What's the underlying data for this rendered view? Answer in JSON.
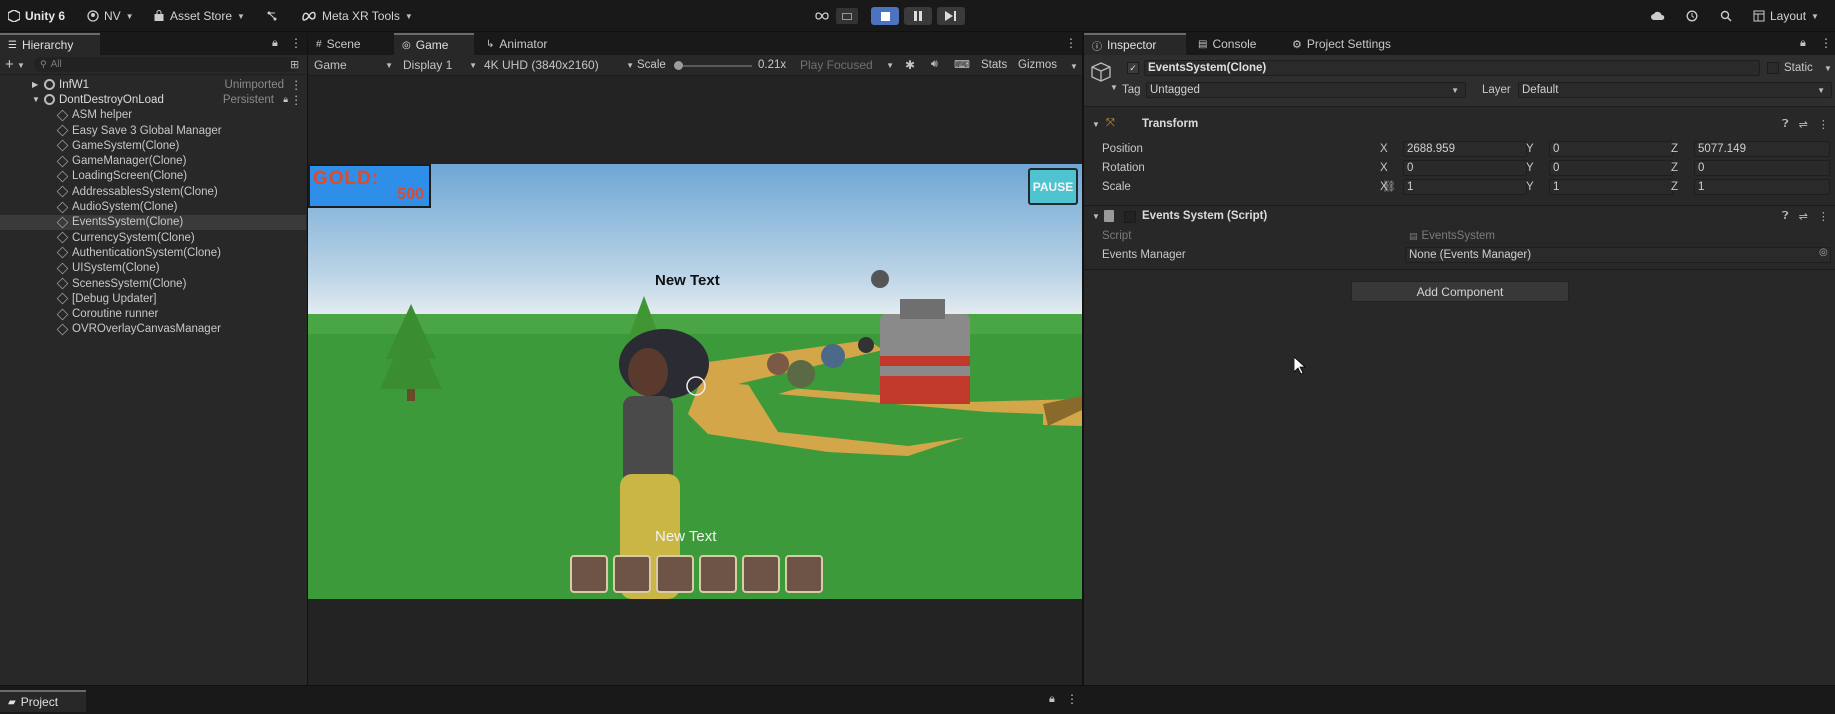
{
  "toolbar": {
    "app_name": "Unity 6",
    "account": "NV",
    "asset_store": "Asset Store",
    "meta_xr": "Meta XR Tools",
    "layout": "Layout"
  },
  "hierarchy": {
    "tab": "Hierarchy",
    "search_placeholder": "All",
    "roots": [
      {
        "name": "InfW1",
        "status": "Unimported"
      },
      {
        "name": "DontDestroyOnLoad",
        "status": "Persistent"
      }
    ],
    "children": [
      "ASM helper",
      "Easy Save 3 Global Manager",
      "GameSystem(Clone)",
      "GameManager(Clone)",
      "LoadingScreen(Clone)",
      "AddressablesSystem(Clone)",
      "AudioSystem(Clone)",
      "EventsSystem(Clone)",
      "CurrencySystem(Clone)",
      "AuthenticationSystem(Clone)",
      "UISystem(Clone)",
      "ScenesSystem(Clone)",
      "[Debug Updater]",
      "Coroutine runner",
      "OVROverlayCanvasManager"
    ],
    "selected_index": 7
  },
  "game_view": {
    "tabs": [
      "Scene",
      "Game",
      "Animator"
    ],
    "active_tab": "Game",
    "mode": "Game",
    "display": "Display 1",
    "resolution": "4K UHD (3840x2160)",
    "scale_label": "Scale",
    "scale_value": "0.21x",
    "scale_level": 0.05,
    "play_mode": "Play Focused",
    "stats": "Stats",
    "gizmos": "Gizmos",
    "gold_label": "GOLD:",
    "gold_value": "500",
    "pause_label": "PAUSE",
    "text_top": "New Text",
    "text_bottom": "New Text",
    "inventory_slots": 6
  },
  "inspector": {
    "tabs": [
      "Inspector",
      "Console",
      "Project Settings"
    ],
    "object_name": "EventsSystem(Clone)",
    "static_label": "Static",
    "tag_label": "Tag",
    "tag_value": "Untagged",
    "layer_label": "Layer",
    "layer_value": "Default",
    "transform": {
      "title": "Transform",
      "position_label": "Position",
      "rotation_label": "Rotation",
      "scale_label": "Scale",
      "position": {
        "x": "2688.959",
        "y": "0",
        "z": "5077.149"
      },
      "rotation": {
        "x": "0",
        "y": "0",
        "z": "0"
      },
      "scale": {
        "x": "1",
        "y": "1",
        "z": "1"
      },
      "axis_x": "X",
      "axis_y": "Y",
      "axis_z": "Z"
    },
    "script_component": {
      "title": "Events System (Script)",
      "script_label": "Script",
      "script_value": "EventsSystem",
      "manager_label": "Events Manager",
      "manager_value": "None (Events Manager)"
    },
    "add_component": "Add Component"
  },
  "project": {
    "tab": "Project"
  },
  "colors": {
    "accent_blue": "#4b73c0",
    "sky_top": "#6fa6d4",
    "grass": "#3d9a3a",
    "path": "#d4a64a",
    "gold_badge": "#2f8fe8",
    "pause_badge": "#4fc3d0"
  }
}
